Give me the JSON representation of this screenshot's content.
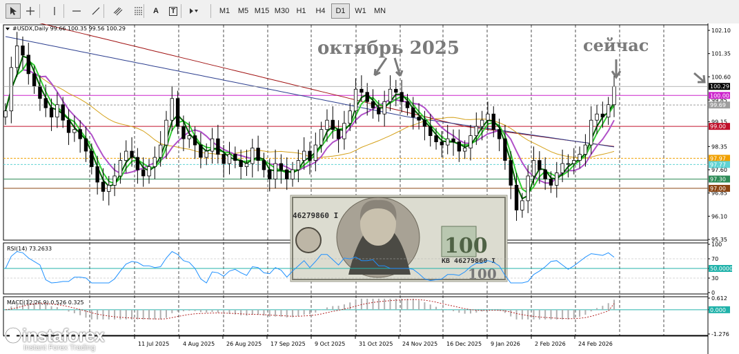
{
  "toolbar": {
    "tools": [
      {
        "icon": "cursor-arrow-icon",
        "active": true
      },
      {
        "icon": "crosshair-icon",
        "active": false
      },
      {
        "icon": "vertical-line-icon",
        "active": false
      },
      {
        "icon": "horizontal-line-icon",
        "active": false
      },
      {
        "icon": "trend-line-icon",
        "active": false
      },
      {
        "icon": "channel-icon",
        "active": false
      },
      {
        "icon": "fibonacci-icon",
        "active": false
      },
      {
        "icon": "text-icon",
        "label": "A",
        "active": false
      },
      {
        "icon": "text-label-icon",
        "label": "T",
        "active": false
      },
      {
        "icon": "arrows-shapes-icon",
        "active": false
      }
    ],
    "timeframes": [
      "M1",
      "M5",
      "M15",
      "M30",
      "H1",
      "H4",
      "D1",
      "W1",
      "MN"
    ],
    "active_timeframe": "D1"
  },
  "chart_data": [
    {
      "type": "candlestick",
      "title": "#USDX,Daily  99.66 100.35 99.56 100.29",
      "symbol": "#USDX",
      "period": "Daily",
      "ohlc_last": {
        "open": 99.66,
        "high": 100.35,
        "low": 99.56,
        "close": 100.29
      },
      "ylim": [
        95.35,
        102.1
      ],
      "y_ticks": [
        102.1,
        101.35,
        100.6,
        99.85,
        99.15,
        98.35,
        97.6,
        96.85,
        96.1,
        95.35
      ],
      "x_tick_labels": [
        "11 Jul 2025",
        "4 Aug 2025",
        "26 Aug 2025",
        "17 Sep 2025",
        "9 Oct 2025",
        "31 Oct 2025",
        "24 Nov 2025",
        "16 Dec 2025",
        "9 Jan 2026",
        "2 Feb 2026",
        "24 Feb 2026"
      ],
      "x_tick_labels_note": "leftmost date label hidden behind logo",
      "current_price": 100.29,
      "price_levels": [
        {
          "value": 100.0,
          "label": "100.00",
          "color": "#cc22cc"
        },
        {
          "value": 99.69,
          "label": "99.69",
          "color": "#9e9e9e"
        },
        {
          "value": 99.0,
          "label": "99.00",
          "color": "#c0102a"
        },
        {
          "value": 97.97,
          "label": "97.97",
          "color": "#f0a000"
        },
        {
          "value": 97.77,
          "label": "97.77",
          "color": "#5fd3d3"
        },
        {
          "value": 97.3,
          "label": "97.30",
          "color": "#2e8b57"
        },
        {
          "value": 97.0,
          "label": "97.00",
          "color": "#8b4513"
        }
      ],
      "close_series": [
        99.5,
        100.9,
        101.6,
        101.3,
        100.7,
        100.3,
        99.9,
        99.6,
        99.3,
        99.7,
        99.2,
        98.8,
        98.9,
        98.6,
        98.2,
        97.7,
        97.2,
        96.9,
        97.1,
        97.4,
        97.9,
        98.2,
        98.0,
        97.6,
        97.4,
        97.7,
        98.0,
        98.4,
        99.2,
        99.9,
        99.0,
        98.6,
        98.7,
        98.4,
        98.0,
        98.2,
        98.6,
        98.1,
        97.8,
        98.1,
        97.9,
        97.7,
        97.8,
        98.3,
        97.9,
        97.6,
        97.3,
        97.8,
        97.6,
        97.3,
        97.6,
        97.9,
        98.2,
        97.9,
        98.4,
        98.9,
        99.2,
        98.9,
        98.6,
        99.1,
        99.5,
        100.2,
        100.1,
        99.8,
        99.6,
        99.4,
        99.8,
        100.2,
        100.1,
        99.8,
        99.6,
        99.3,
        99.2,
        99.0,
        98.7,
        98.5,
        98.4,
        98.6,
        98.5,
        98.2,
        98.3,
        98.7,
        99.0,
        99.2,
        99.4,
        98.9,
        98.6,
        97.9,
        97.1,
        96.3,
        96.6,
        97.4,
        97.9,
        97.6,
        97.3,
        97.1,
        97.5,
        97.8,
        97.8,
        97.9,
        98.1,
        98.4,
        99.2,
        99.4,
        99.3,
        99.7,
        100.29
      ],
      "moving_averages": [
        {
          "name": "MA dark green",
          "color": "#006400"
        },
        {
          "name": "MA light green",
          "color": "#32cd32"
        },
        {
          "name": "MA violet",
          "color": "#b050c8"
        },
        {
          "name": "MA brown",
          "color": "#b8860b"
        },
        {
          "name": "MA navy",
          "color": "#2c3e8f"
        },
        {
          "name": "MA dark red",
          "color": "#a01010"
        }
      ],
      "annotations": [
        {
          "text": "октябрь 2025"
        },
        {
          "text": "сейчас"
        }
      ],
      "image_label": {
        "serial_left": "46279860 I",
        "serial_right": "KB 46279860 I",
        "denomination": "100"
      }
    },
    {
      "type": "line",
      "title": "RSI(14) 73.2633",
      "ylim": [
        0,
        100
      ],
      "y_ticks": [
        100,
        70,
        50,
        30,
        0
      ],
      "levels": [
        {
          "value": 50,
          "label": "50.0000",
          "color": "#20b2aa"
        }
      ],
      "last_value": 73.2633
    },
    {
      "type": "bar",
      "title": "MACD(12,26,9) 0.526 0.325",
      "ylim": [
        -1.276,
        0.612
      ],
      "y_ticks": [
        0.612,
        0.0,
        -1.276
      ],
      "levels": [
        {
          "value": 0.0,
          "label": "0.000",
          "color": "#20b2aa"
        }
      ],
      "macd": 0.526,
      "signal": 0.325
    }
  ],
  "logo": {
    "main": "instaforex",
    "sub": "Instant Forex Trading"
  }
}
